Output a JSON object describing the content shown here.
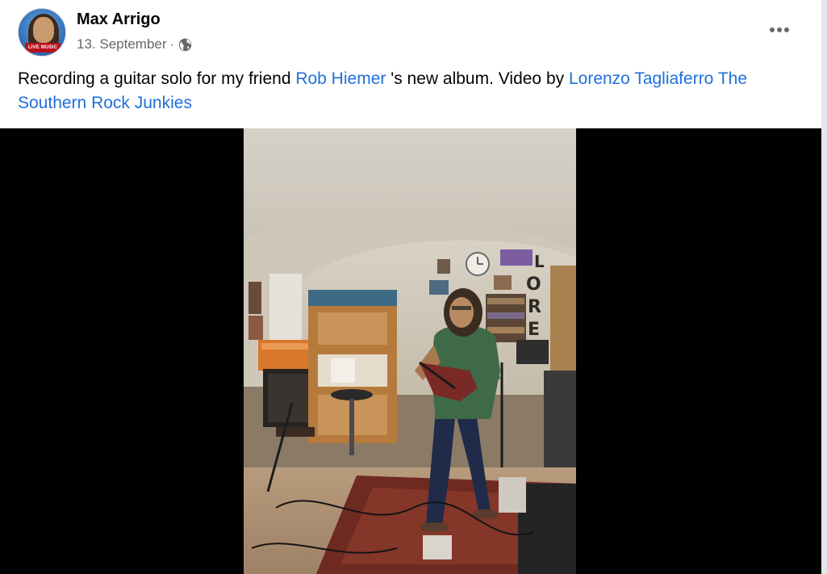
{
  "post": {
    "author": {
      "name": "Max Arrigo",
      "avatar_badge": "LIVE MUSIC"
    },
    "date": "13. September",
    "separator": "·",
    "audience_icon": "globe-icon",
    "more_icon": "more-horizontal-icon",
    "caption": {
      "text_before": "Recording a guitar solo for my friend ",
      "mention_1": "Rob Hiemer",
      "text_middle": " 's new album. Video by ",
      "mention_2": "Lorenzo Tagliaferro",
      "text_space": " ",
      "mention_3": "The Southern Rock Junkies"
    },
    "video": {
      "wall_letters": [
        "L",
        "O",
        "R",
        "E"
      ]
    }
  },
  "colors": {
    "link": "#216fdb",
    "text_primary": "#050505",
    "text_secondary": "#65676b",
    "background": "#ffffff",
    "video_background": "#000000"
  }
}
